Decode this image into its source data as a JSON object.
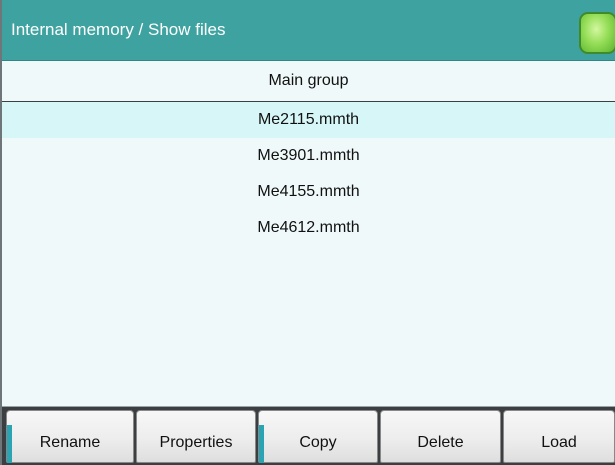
{
  "window": {
    "title": "Internal memory / Show files"
  },
  "status_indicator": {
    "color": "#8ed650"
  },
  "list": {
    "group_label": "Main group",
    "files": [
      "Me2115.mmth",
      "Me3901.mmth",
      "Me4155.mmth",
      "Me4612.mmth"
    ],
    "selected_index": 0
  },
  "buttons": {
    "rename": "Rename",
    "properties": "Properties",
    "copy": "Copy",
    "delete": "Delete",
    "load": "Load"
  },
  "colors": {
    "titlebar": "#3ea3a0",
    "selection": "#d6f6f7",
    "accent": "#2aa4b2"
  }
}
